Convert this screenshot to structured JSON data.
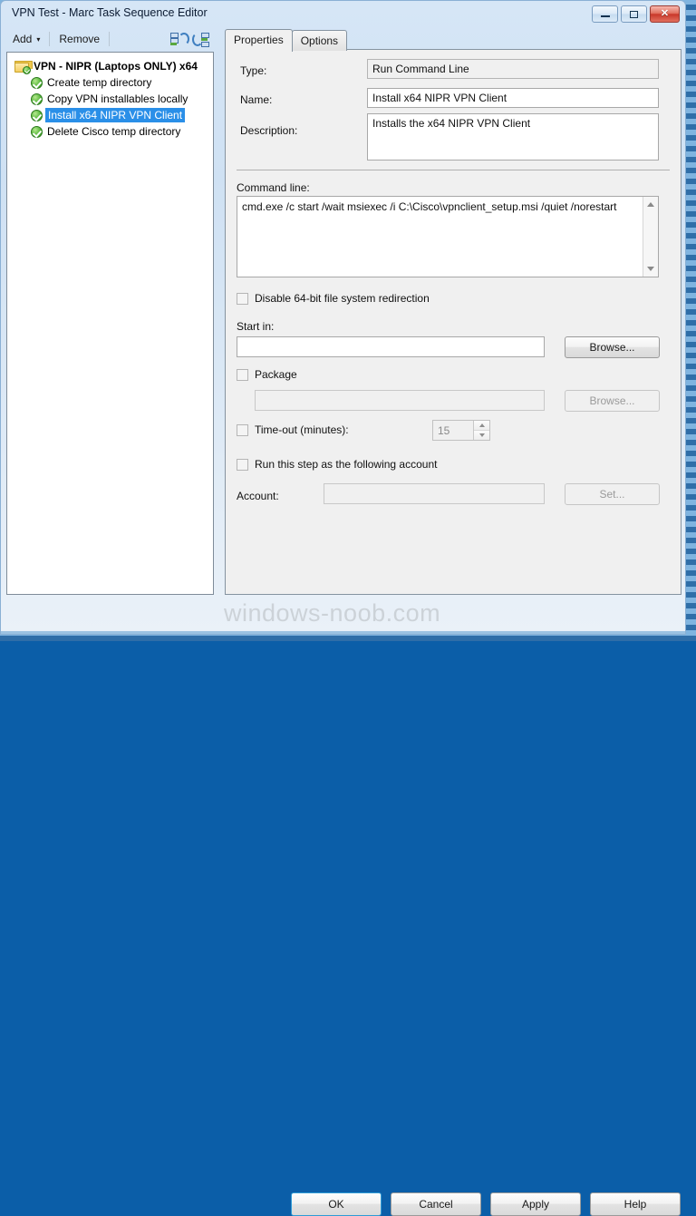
{
  "window": {
    "title": "VPN Test - Marc Task Sequence Editor",
    "controls": {
      "minimize": "minimize-button",
      "maximize": "maximize-button",
      "close": "✕"
    }
  },
  "toolbar": {
    "add_label": "Add",
    "add_caret": "▾",
    "remove_label": "Remove",
    "icon_move_up": "move-up-icon",
    "icon_move_down": "move-down-icon"
  },
  "tree": {
    "nodes": [
      {
        "label": "VPN - NIPR (Laptops ONLY) x64",
        "level": 0,
        "icon": "folder-check-icon",
        "selected": false
      },
      {
        "label": "Create temp directory",
        "level": 1,
        "icon": "green-check-icon",
        "selected": false
      },
      {
        "label": "Copy VPN installables locally",
        "level": 1,
        "icon": "green-check-icon",
        "selected": false
      },
      {
        "label": "Install x64 NIPR VPN Client",
        "level": 1,
        "icon": "green-check-icon",
        "selected": true
      },
      {
        "label": "Delete Cisco temp directory",
        "level": 1,
        "icon": "green-check-icon",
        "selected": false
      }
    ]
  },
  "tabs": [
    {
      "label": "Properties",
      "active": true
    },
    {
      "label": "Options",
      "active": false
    }
  ],
  "properties": {
    "type_label": "Type:",
    "type_value": "Run Command Line",
    "name_label": "Name:",
    "name_value": "Install x64 NIPR VPN Client",
    "description_label": "Description:",
    "description_value": "Installs the x64 NIPR VPN Client",
    "commandline_label": "Command line:",
    "commandline_value": "cmd.exe /c start /wait msiexec /i C:\\Cisco\\vpnclient_setup.msi /quiet /norestart",
    "disable_redirection_label": "Disable 64-bit file system redirection",
    "disable_redirection_checked": false,
    "startin_label": "Start in:",
    "startin_value": "",
    "startin_browse_label": "Browse...",
    "package_label": "Package",
    "package_checked": false,
    "package_value": "",
    "package_browse_label": "Browse...",
    "timeout_label": "Time-out (minutes):",
    "timeout_checked": false,
    "timeout_value": "15",
    "runas_label": "Run this step as the following account",
    "runas_checked": false,
    "account_label": "Account:",
    "account_value": "",
    "account_set_label": "Set..."
  },
  "footer": {
    "ok": "OK",
    "cancel": "Cancel",
    "apply": "Apply",
    "help": "Help"
  },
  "watermark": "windows-noob.com",
  "colors": {
    "selection_blue": "#2a8fe8",
    "title_gradient_top": "#d6e6f6",
    "dialog_bg": "#f0f0f0",
    "close_red": "#c9382a",
    "check_green": "#56b63a"
  }
}
